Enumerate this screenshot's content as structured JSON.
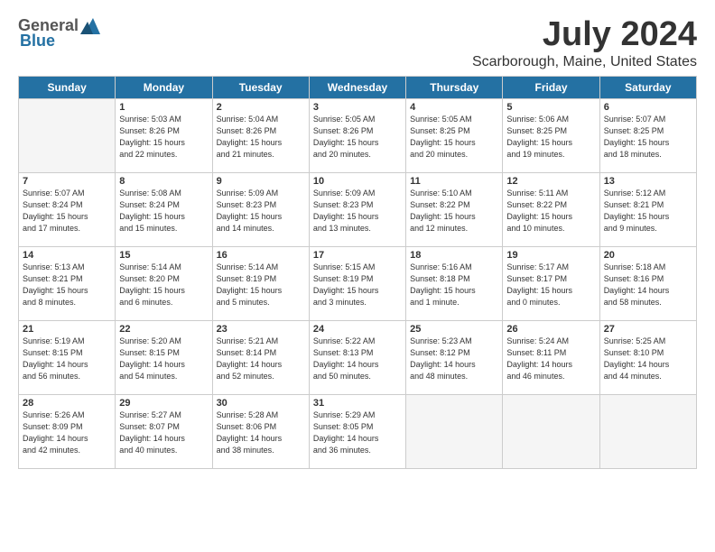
{
  "logo": {
    "general": "General",
    "blue": "Blue"
  },
  "title": "July 2024",
  "subtitle": "Scarborough, Maine, United States",
  "headers": [
    "Sunday",
    "Monday",
    "Tuesday",
    "Wednesday",
    "Thursday",
    "Friday",
    "Saturday"
  ],
  "weeks": [
    [
      {
        "num": "",
        "info": ""
      },
      {
        "num": "1",
        "info": "Sunrise: 5:03 AM\nSunset: 8:26 PM\nDaylight: 15 hours\nand 22 minutes."
      },
      {
        "num": "2",
        "info": "Sunrise: 5:04 AM\nSunset: 8:26 PM\nDaylight: 15 hours\nand 21 minutes."
      },
      {
        "num": "3",
        "info": "Sunrise: 5:05 AM\nSunset: 8:26 PM\nDaylight: 15 hours\nand 20 minutes."
      },
      {
        "num": "4",
        "info": "Sunrise: 5:05 AM\nSunset: 8:25 PM\nDaylight: 15 hours\nand 20 minutes."
      },
      {
        "num": "5",
        "info": "Sunrise: 5:06 AM\nSunset: 8:25 PM\nDaylight: 15 hours\nand 19 minutes."
      },
      {
        "num": "6",
        "info": "Sunrise: 5:07 AM\nSunset: 8:25 PM\nDaylight: 15 hours\nand 18 minutes."
      }
    ],
    [
      {
        "num": "7",
        "info": "Sunrise: 5:07 AM\nSunset: 8:24 PM\nDaylight: 15 hours\nand 17 minutes."
      },
      {
        "num": "8",
        "info": "Sunrise: 5:08 AM\nSunset: 8:24 PM\nDaylight: 15 hours\nand 15 minutes."
      },
      {
        "num": "9",
        "info": "Sunrise: 5:09 AM\nSunset: 8:23 PM\nDaylight: 15 hours\nand 14 minutes."
      },
      {
        "num": "10",
        "info": "Sunrise: 5:09 AM\nSunset: 8:23 PM\nDaylight: 15 hours\nand 13 minutes."
      },
      {
        "num": "11",
        "info": "Sunrise: 5:10 AM\nSunset: 8:22 PM\nDaylight: 15 hours\nand 12 minutes."
      },
      {
        "num": "12",
        "info": "Sunrise: 5:11 AM\nSunset: 8:22 PM\nDaylight: 15 hours\nand 10 minutes."
      },
      {
        "num": "13",
        "info": "Sunrise: 5:12 AM\nSunset: 8:21 PM\nDaylight: 15 hours\nand 9 minutes."
      }
    ],
    [
      {
        "num": "14",
        "info": "Sunrise: 5:13 AM\nSunset: 8:21 PM\nDaylight: 15 hours\nand 8 minutes."
      },
      {
        "num": "15",
        "info": "Sunrise: 5:14 AM\nSunset: 8:20 PM\nDaylight: 15 hours\nand 6 minutes."
      },
      {
        "num": "16",
        "info": "Sunrise: 5:14 AM\nSunset: 8:19 PM\nDaylight: 15 hours\nand 5 minutes."
      },
      {
        "num": "17",
        "info": "Sunrise: 5:15 AM\nSunset: 8:19 PM\nDaylight: 15 hours\nand 3 minutes."
      },
      {
        "num": "18",
        "info": "Sunrise: 5:16 AM\nSunset: 8:18 PM\nDaylight: 15 hours\nand 1 minute."
      },
      {
        "num": "19",
        "info": "Sunrise: 5:17 AM\nSunset: 8:17 PM\nDaylight: 15 hours\nand 0 minutes."
      },
      {
        "num": "20",
        "info": "Sunrise: 5:18 AM\nSunset: 8:16 PM\nDaylight: 14 hours\nand 58 minutes."
      }
    ],
    [
      {
        "num": "21",
        "info": "Sunrise: 5:19 AM\nSunset: 8:15 PM\nDaylight: 14 hours\nand 56 minutes."
      },
      {
        "num": "22",
        "info": "Sunrise: 5:20 AM\nSunset: 8:15 PM\nDaylight: 14 hours\nand 54 minutes."
      },
      {
        "num": "23",
        "info": "Sunrise: 5:21 AM\nSunset: 8:14 PM\nDaylight: 14 hours\nand 52 minutes."
      },
      {
        "num": "24",
        "info": "Sunrise: 5:22 AM\nSunset: 8:13 PM\nDaylight: 14 hours\nand 50 minutes."
      },
      {
        "num": "25",
        "info": "Sunrise: 5:23 AM\nSunset: 8:12 PM\nDaylight: 14 hours\nand 48 minutes."
      },
      {
        "num": "26",
        "info": "Sunrise: 5:24 AM\nSunset: 8:11 PM\nDaylight: 14 hours\nand 46 minutes."
      },
      {
        "num": "27",
        "info": "Sunrise: 5:25 AM\nSunset: 8:10 PM\nDaylight: 14 hours\nand 44 minutes."
      }
    ],
    [
      {
        "num": "28",
        "info": "Sunrise: 5:26 AM\nSunset: 8:09 PM\nDaylight: 14 hours\nand 42 minutes."
      },
      {
        "num": "29",
        "info": "Sunrise: 5:27 AM\nSunset: 8:07 PM\nDaylight: 14 hours\nand 40 minutes."
      },
      {
        "num": "30",
        "info": "Sunrise: 5:28 AM\nSunset: 8:06 PM\nDaylight: 14 hours\nand 38 minutes."
      },
      {
        "num": "31",
        "info": "Sunrise: 5:29 AM\nSunset: 8:05 PM\nDaylight: 14 hours\nand 36 minutes."
      },
      {
        "num": "",
        "info": ""
      },
      {
        "num": "",
        "info": ""
      },
      {
        "num": "",
        "info": ""
      }
    ]
  ]
}
